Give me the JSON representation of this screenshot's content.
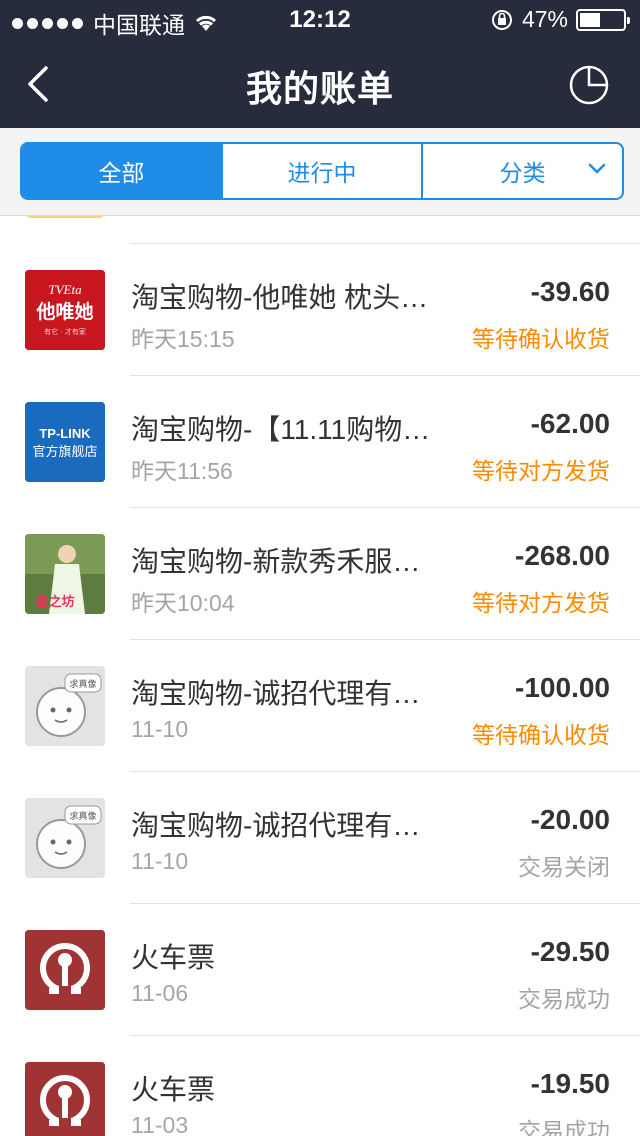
{
  "status_bar": {
    "carrier": "中国联通",
    "time": "12:12",
    "battery_pct": "47%",
    "battery_level": 0.47
  },
  "nav": {
    "title": "我的账单"
  },
  "segments": [
    {
      "label": "全部",
      "active": true
    },
    {
      "label": "进行中",
      "active": false
    },
    {
      "label": "分类",
      "active": false
    }
  ],
  "bills": [
    {
      "title": "淘宝购物-他唯她 枕头…",
      "date": "昨天15:15",
      "amount": "-39.60",
      "status": "等待确认收货",
      "status_color": "orange",
      "icon": "tveta-logo",
      "logo_text_top": "TVEta",
      "logo_text_main": "他唯她",
      "logo_text_sub": "有它 · 才有家"
    },
    {
      "title": "淘宝购物-【11.11购物…",
      "date": "昨天11:56",
      "amount": "-62.00",
      "status": "等待对方发货",
      "status_color": "orange",
      "icon": "tplink-logo",
      "logo_text_top": "TP-LINK",
      "logo_text_main": "官方旗舰店"
    },
    {
      "title": "淘宝购物-新款秀禾服…",
      "date": "昨天10:04",
      "amount": "-268.00",
      "status": "等待对方发货",
      "status_color": "orange",
      "icon": "product-photo",
      "logo_text_main": "喜之坊"
    },
    {
      "title": "淘宝购物-诚招代理有…",
      "date": "11-10",
      "amount": "-100.00",
      "status": "等待确认收货",
      "status_color": "orange",
      "icon": "default-avatar",
      "logo_text_main": "求真像"
    },
    {
      "title": "淘宝购物-诚招代理有…",
      "date": "11-10",
      "amount": "-20.00",
      "status": "交易关闭",
      "status_color": "gray",
      "icon": "default-avatar",
      "logo_text_main": "求真像"
    },
    {
      "title": "火车票",
      "date": "11-06",
      "amount": "-29.50",
      "status": "交易成功",
      "status_color": "gray",
      "icon": "railway-logo"
    },
    {
      "title": "火车票",
      "date": "11-03",
      "amount": "-19.50",
      "status": "交易成功",
      "status_color": "gray",
      "icon": "railway-logo"
    }
  ]
}
